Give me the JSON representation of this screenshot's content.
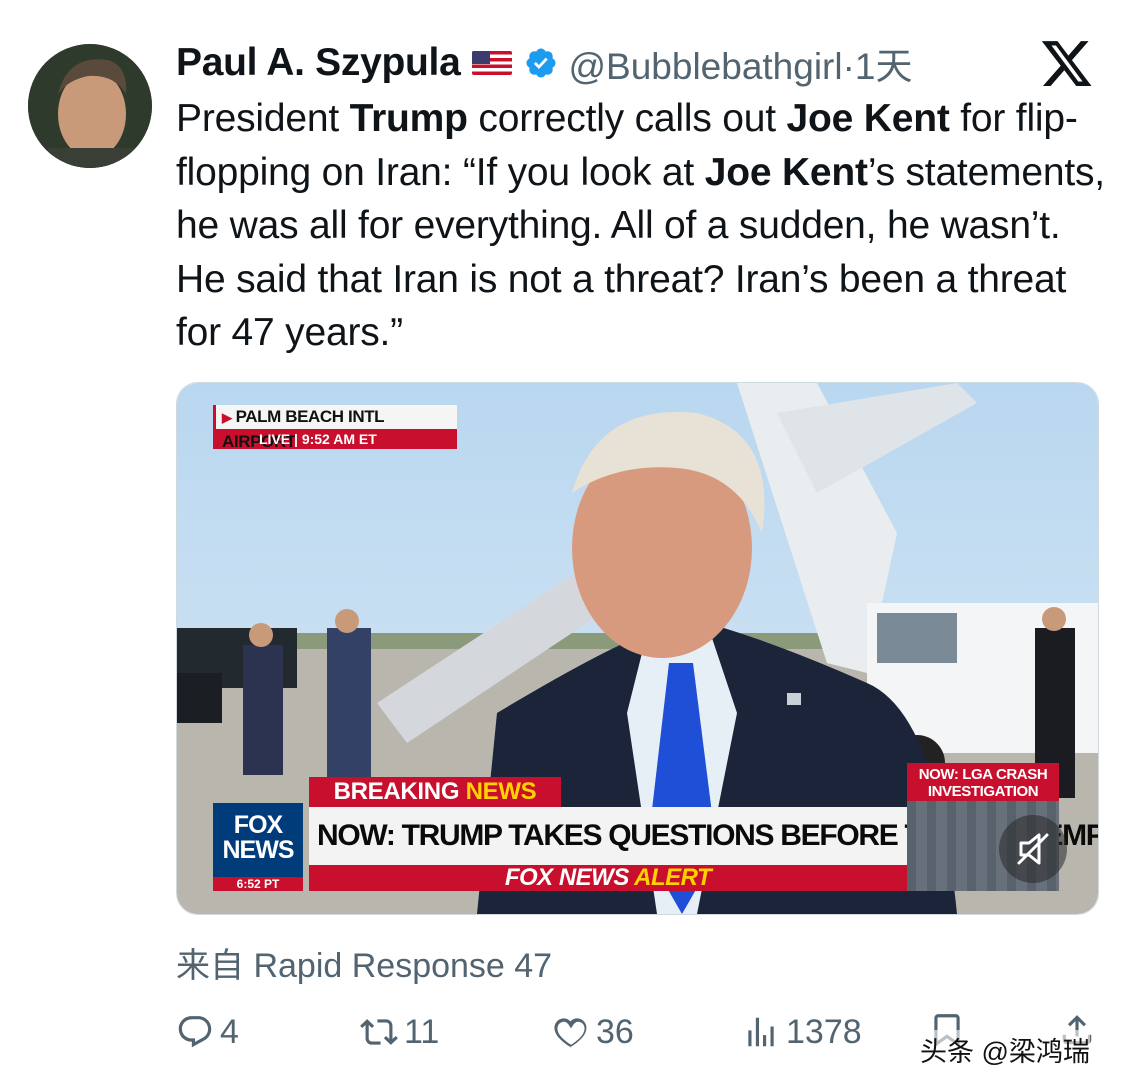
{
  "tweet": {
    "author_name": "Paul A. Szypula",
    "handle": "@Bubblebathgirl",
    "separator": "·",
    "time": "1天",
    "text": {
      "t1": "President ",
      "b1": "Trump",
      "t2": " correctly calls out ",
      "b2": "Joe Kent",
      "t3": " for flip-flopping on Iran: “If you look at ",
      "b3": "Joe Kent",
      "t4": "’s statements, he was all for everything. All of a sudden, he wasn’t. He said that Iran is not a threat? Iran’s been a threat for 47 years.”"
    },
    "source": "来自 Rapid Response 47",
    "replies": "4",
    "reposts": "11",
    "likes": "36",
    "views": "1378"
  },
  "video": {
    "location": "PALM BEACH INTL AIRPORT",
    "live_line": "LIVE  |  9:52 AM ET",
    "breaking_1": "BREAKING ",
    "breaking_2": "NEWS",
    "headline": "NOW: TRUMP TAKES QUESTIONS BEFORE TRIP TO MEMPHIS",
    "alert_1": "FOX NEWS ",
    "alert_2": "ALERT",
    "logo_line1": "FOX",
    "logo_line2": "NEWS",
    "logo_time": "6:52 PT",
    "side_title": "NOW: LGA CRASH INVESTIGATION"
  },
  "watermark": "头条 @梁鸿瑞",
  "colors": {
    "text": "#0f1419",
    "muted": "#536471",
    "verified": "#1d9bf0",
    "fox_red": "#c8102e",
    "fox_yellow": "#ffd200"
  },
  "icons": [
    "x-logo-icon",
    "verified-badge-icon",
    "us-flag-icon",
    "reply-icon",
    "repost-icon",
    "like-icon",
    "views-icon",
    "bookmark-icon",
    "share-icon",
    "mute-icon"
  ]
}
